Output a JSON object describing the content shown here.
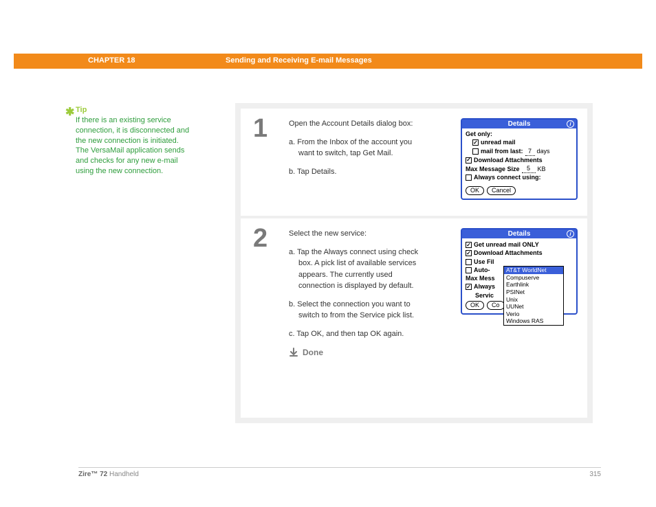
{
  "header": {
    "chapter": "CHAPTER 18",
    "title": "Sending and Receiving E-mail Messages"
  },
  "tip": {
    "label": "Tip",
    "body": "If there is an existing service connection, it is disconnected and the new connection is initiated. The VersaMail application sends and checks for any new e-mail using the new connection."
  },
  "step1": {
    "num": "1",
    "intro": "Open the Account Details dialog box:",
    "a": "a.  From the Inbox of the account you want to switch, tap Get Mail.",
    "b": "b.  Tap Details."
  },
  "step2": {
    "num": "2",
    "intro": "Select the new service:",
    "a": "a.  Tap the Always connect using check box. A pick list of available services appears. The currently used connection is displayed by default.",
    "b": "b.  Select the connection you want to switch to from the Service pick list.",
    "c": "c.  Tap OK, and then tap OK again.",
    "done": "Done"
  },
  "palm1": {
    "title": "Details",
    "getonly": "Get only:",
    "unread": "unread mail",
    "mailfrom": "mail from last:",
    "days_val": "7",
    "days_unit": "days",
    "dl_attach": "Download Attachments",
    "maxsize_label": "Max Message Size",
    "maxsize_val": "5",
    "maxsize_unit": "KB",
    "always": "Always connect using:",
    "ok": "OK",
    "cancel": "Cancel"
  },
  "palm2": {
    "title": "Details",
    "unread_only": "Get unread mail ONLY",
    "dl_attach": "Download Attachments",
    "use_fil": "Use Fil",
    "auto": "Auto-",
    "maxmsg": "Max Mess",
    "always": "Always",
    "service": "Servic",
    "ok": "OK",
    "cancel_partial": "Co",
    "dropdown": [
      "AT&T WorldNet",
      "Compuserve",
      "Earthlink",
      "PSINet",
      "Unix",
      "UUNet",
      "Verio",
      "Windows RAS"
    ]
  },
  "footer": {
    "product_bold": "Zire™ 72",
    "product_rest": " Handheld",
    "page": "315"
  }
}
